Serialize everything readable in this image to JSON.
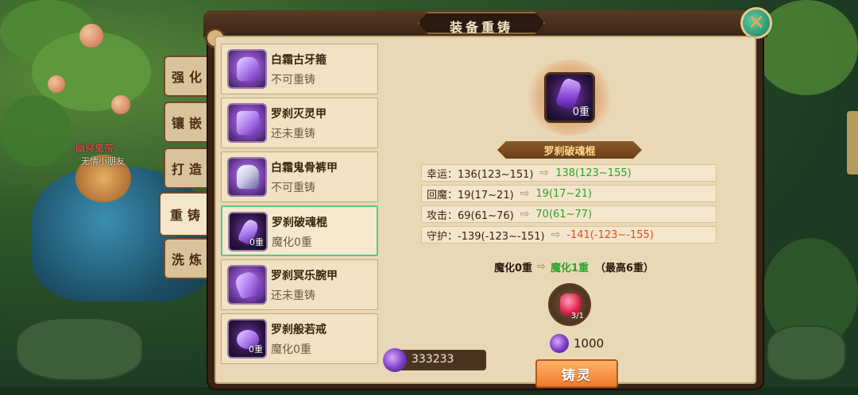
{
  "scene": {
    "npc_name": "幽冥鬼帝",
    "npc_subtitle": "无情小朋友"
  },
  "panel": {
    "title": "装备重铸"
  },
  "tabs": [
    {
      "label": "强化",
      "active": false
    },
    {
      "label": "镶嵌",
      "active": false
    },
    {
      "label": "打造",
      "active": false
    },
    {
      "label": "重铸",
      "active": true
    },
    {
      "label": "洗炼",
      "active": false
    }
  ],
  "items": [
    {
      "name": "白霜古牙箍",
      "status": "不可重铸",
      "level": "",
      "icon": "frost-fang-headband-icon"
    },
    {
      "name": "罗刹灭灵甲",
      "status": "还未重铸",
      "level": "",
      "icon": "rakshasa-armor-icon"
    },
    {
      "name": "白霜鬼骨裤甲",
      "status": "不可重铸",
      "level": "",
      "icon": "frost-bone-greaves-icon"
    },
    {
      "name": "罗刹破魂棍",
      "status": "魔化0重",
      "level": "0重",
      "icon": "rakshasa-staff-icon",
      "selected": true
    },
    {
      "name": "罗刹冥乐腕甲",
      "status": "还未重铸",
      "level": "",
      "icon": "rakshasa-bracer-icon"
    },
    {
      "name": "罗刹般若戒",
      "status": "魔化0重",
      "level": "0重",
      "icon": "rakshasa-ring-icon"
    }
  ],
  "currency": {
    "amount": "333233",
    "icon": "purple-crystal-icon"
  },
  "detail": {
    "equip_name": "罗刹破魂棍",
    "equip_level": "0重",
    "stats": [
      {
        "label": "幸运：136(123~151)",
        "new": "138(123~155)",
        "trend": "up"
      },
      {
        "label": "回魔：19(17~21)",
        "new": "19(17~21)",
        "trend": "up"
      },
      {
        "label": "攻击：69(61~76)",
        "new": "70(61~77)",
        "trend": "up"
      },
      {
        "label": "守护：-139(-123~-151)",
        "new": "-141(-123~-155)",
        "trend": "down"
      }
    ],
    "magic_current": "魔化0重",
    "magic_next": "魔化1重",
    "magic_max": "（最高6重）",
    "material_count": "3/1",
    "cost": "1000",
    "forge_label": "铸灵"
  },
  "colors": {
    "stat_up": "#2aa32a",
    "stat_down": "#e14a1c",
    "forge_button": "#f07a2a",
    "selected_border": "#57c98a"
  }
}
